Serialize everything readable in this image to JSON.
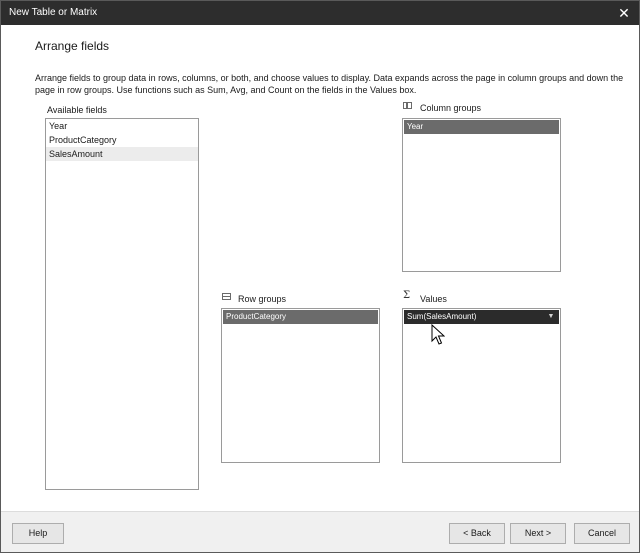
{
  "window": {
    "title": "New Table or Matrix"
  },
  "page": {
    "heading": "Arrange fields",
    "description": "Arrange fields to group data in rows, columns, or both, and choose values to display. Data expands across the page in column groups and down the page in row groups.  Use functions such as Sum, Avg, and Count on the fields in the Values box."
  },
  "available_fields": {
    "label": "Available fields",
    "items": [
      "Year",
      "ProductCategory",
      "SalesAmount"
    ]
  },
  "column_groups": {
    "label": "Column groups",
    "items": [
      "Year"
    ]
  },
  "row_groups": {
    "label": "Row groups",
    "items": [
      "ProductCategory"
    ]
  },
  "values": {
    "label": "Values",
    "items": [
      "Sum(SalesAmount)"
    ]
  },
  "footer": {
    "help_label": "Help",
    "back_label": "< Back",
    "next_label": "Next >",
    "cancel_label": "Cancel"
  },
  "colors": {
    "titlebar": "#2d2d2d",
    "chip": "#6b6b6b",
    "chip_selected": "#2b2b2b"
  }
}
